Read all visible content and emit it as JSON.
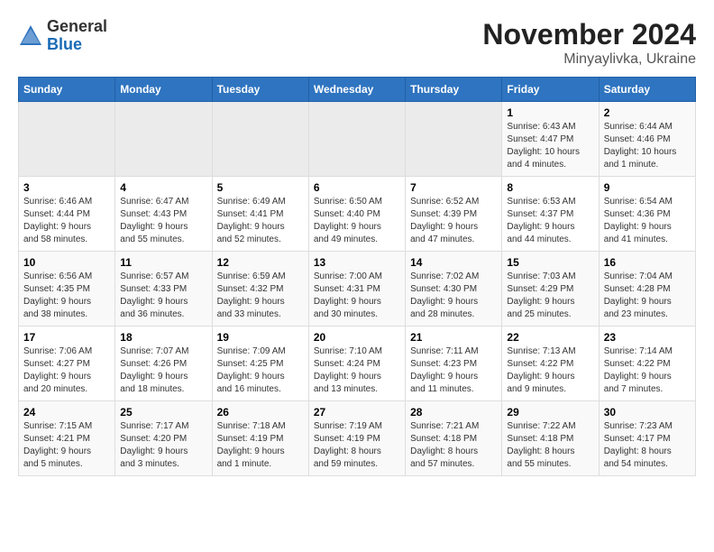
{
  "header": {
    "logo_line1": "General",
    "logo_line2": "Blue",
    "title": "November 2024",
    "subtitle": "Minyaylivka, Ukraine"
  },
  "days_of_week": [
    "Sunday",
    "Monday",
    "Tuesday",
    "Wednesday",
    "Thursday",
    "Friday",
    "Saturday"
  ],
  "weeks": [
    [
      {
        "day": "",
        "info": ""
      },
      {
        "day": "",
        "info": ""
      },
      {
        "day": "",
        "info": ""
      },
      {
        "day": "",
        "info": ""
      },
      {
        "day": "",
        "info": ""
      },
      {
        "day": "1",
        "info": "Sunrise: 6:43 AM\nSunset: 4:47 PM\nDaylight: 10 hours\nand 4 minutes."
      },
      {
        "day": "2",
        "info": "Sunrise: 6:44 AM\nSunset: 4:46 PM\nDaylight: 10 hours\nand 1 minute."
      }
    ],
    [
      {
        "day": "3",
        "info": "Sunrise: 6:46 AM\nSunset: 4:44 PM\nDaylight: 9 hours\nand 58 minutes."
      },
      {
        "day": "4",
        "info": "Sunrise: 6:47 AM\nSunset: 4:43 PM\nDaylight: 9 hours\nand 55 minutes."
      },
      {
        "day": "5",
        "info": "Sunrise: 6:49 AM\nSunset: 4:41 PM\nDaylight: 9 hours\nand 52 minutes."
      },
      {
        "day": "6",
        "info": "Sunrise: 6:50 AM\nSunset: 4:40 PM\nDaylight: 9 hours\nand 49 minutes."
      },
      {
        "day": "7",
        "info": "Sunrise: 6:52 AM\nSunset: 4:39 PM\nDaylight: 9 hours\nand 47 minutes."
      },
      {
        "day": "8",
        "info": "Sunrise: 6:53 AM\nSunset: 4:37 PM\nDaylight: 9 hours\nand 44 minutes."
      },
      {
        "day": "9",
        "info": "Sunrise: 6:54 AM\nSunset: 4:36 PM\nDaylight: 9 hours\nand 41 minutes."
      }
    ],
    [
      {
        "day": "10",
        "info": "Sunrise: 6:56 AM\nSunset: 4:35 PM\nDaylight: 9 hours\nand 38 minutes."
      },
      {
        "day": "11",
        "info": "Sunrise: 6:57 AM\nSunset: 4:33 PM\nDaylight: 9 hours\nand 36 minutes."
      },
      {
        "day": "12",
        "info": "Sunrise: 6:59 AM\nSunset: 4:32 PM\nDaylight: 9 hours\nand 33 minutes."
      },
      {
        "day": "13",
        "info": "Sunrise: 7:00 AM\nSunset: 4:31 PM\nDaylight: 9 hours\nand 30 minutes."
      },
      {
        "day": "14",
        "info": "Sunrise: 7:02 AM\nSunset: 4:30 PM\nDaylight: 9 hours\nand 28 minutes."
      },
      {
        "day": "15",
        "info": "Sunrise: 7:03 AM\nSunset: 4:29 PM\nDaylight: 9 hours\nand 25 minutes."
      },
      {
        "day": "16",
        "info": "Sunrise: 7:04 AM\nSunset: 4:28 PM\nDaylight: 9 hours\nand 23 minutes."
      }
    ],
    [
      {
        "day": "17",
        "info": "Sunrise: 7:06 AM\nSunset: 4:27 PM\nDaylight: 9 hours\nand 20 minutes."
      },
      {
        "day": "18",
        "info": "Sunrise: 7:07 AM\nSunset: 4:26 PM\nDaylight: 9 hours\nand 18 minutes."
      },
      {
        "day": "19",
        "info": "Sunrise: 7:09 AM\nSunset: 4:25 PM\nDaylight: 9 hours\nand 16 minutes."
      },
      {
        "day": "20",
        "info": "Sunrise: 7:10 AM\nSunset: 4:24 PM\nDaylight: 9 hours\nand 13 minutes."
      },
      {
        "day": "21",
        "info": "Sunrise: 7:11 AM\nSunset: 4:23 PM\nDaylight: 9 hours\nand 11 minutes."
      },
      {
        "day": "22",
        "info": "Sunrise: 7:13 AM\nSunset: 4:22 PM\nDaylight: 9 hours\nand 9 minutes."
      },
      {
        "day": "23",
        "info": "Sunrise: 7:14 AM\nSunset: 4:22 PM\nDaylight: 9 hours\nand 7 minutes."
      }
    ],
    [
      {
        "day": "24",
        "info": "Sunrise: 7:15 AM\nSunset: 4:21 PM\nDaylight: 9 hours\nand 5 minutes."
      },
      {
        "day": "25",
        "info": "Sunrise: 7:17 AM\nSunset: 4:20 PM\nDaylight: 9 hours\nand 3 minutes."
      },
      {
        "day": "26",
        "info": "Sunrise: 7:18 AM\nSunset: 4:19 PM\nDaylight: 9 hours\nand 1 minute."
      },
      {
        "day": "27",
        "info": "Sunrise: 7:19 AM\nSunset: 4:19 PM\nDaylight: 8 hours\nand 59 minutes."
      },
      {
        "day": "28",
        "info": "Sunrise: 7:21 AM\nSunset: 4:18 PM\nDaylight: 8 hours\nand 57 minutes."
      },
      {
        "day": "29",
        "info": "Sunrise: 7:22 AM\nSunset: 4:18 PM\nDaylight: 8 hours\nand 55 minutes."
      },
      {
        "day": "30",
        "info": "Sunrise: 7:23 AM\nSunset: 4:17 PM\nDaylight: 8 hours\nand 54 minutes."
      }
    ]
  ]
}
